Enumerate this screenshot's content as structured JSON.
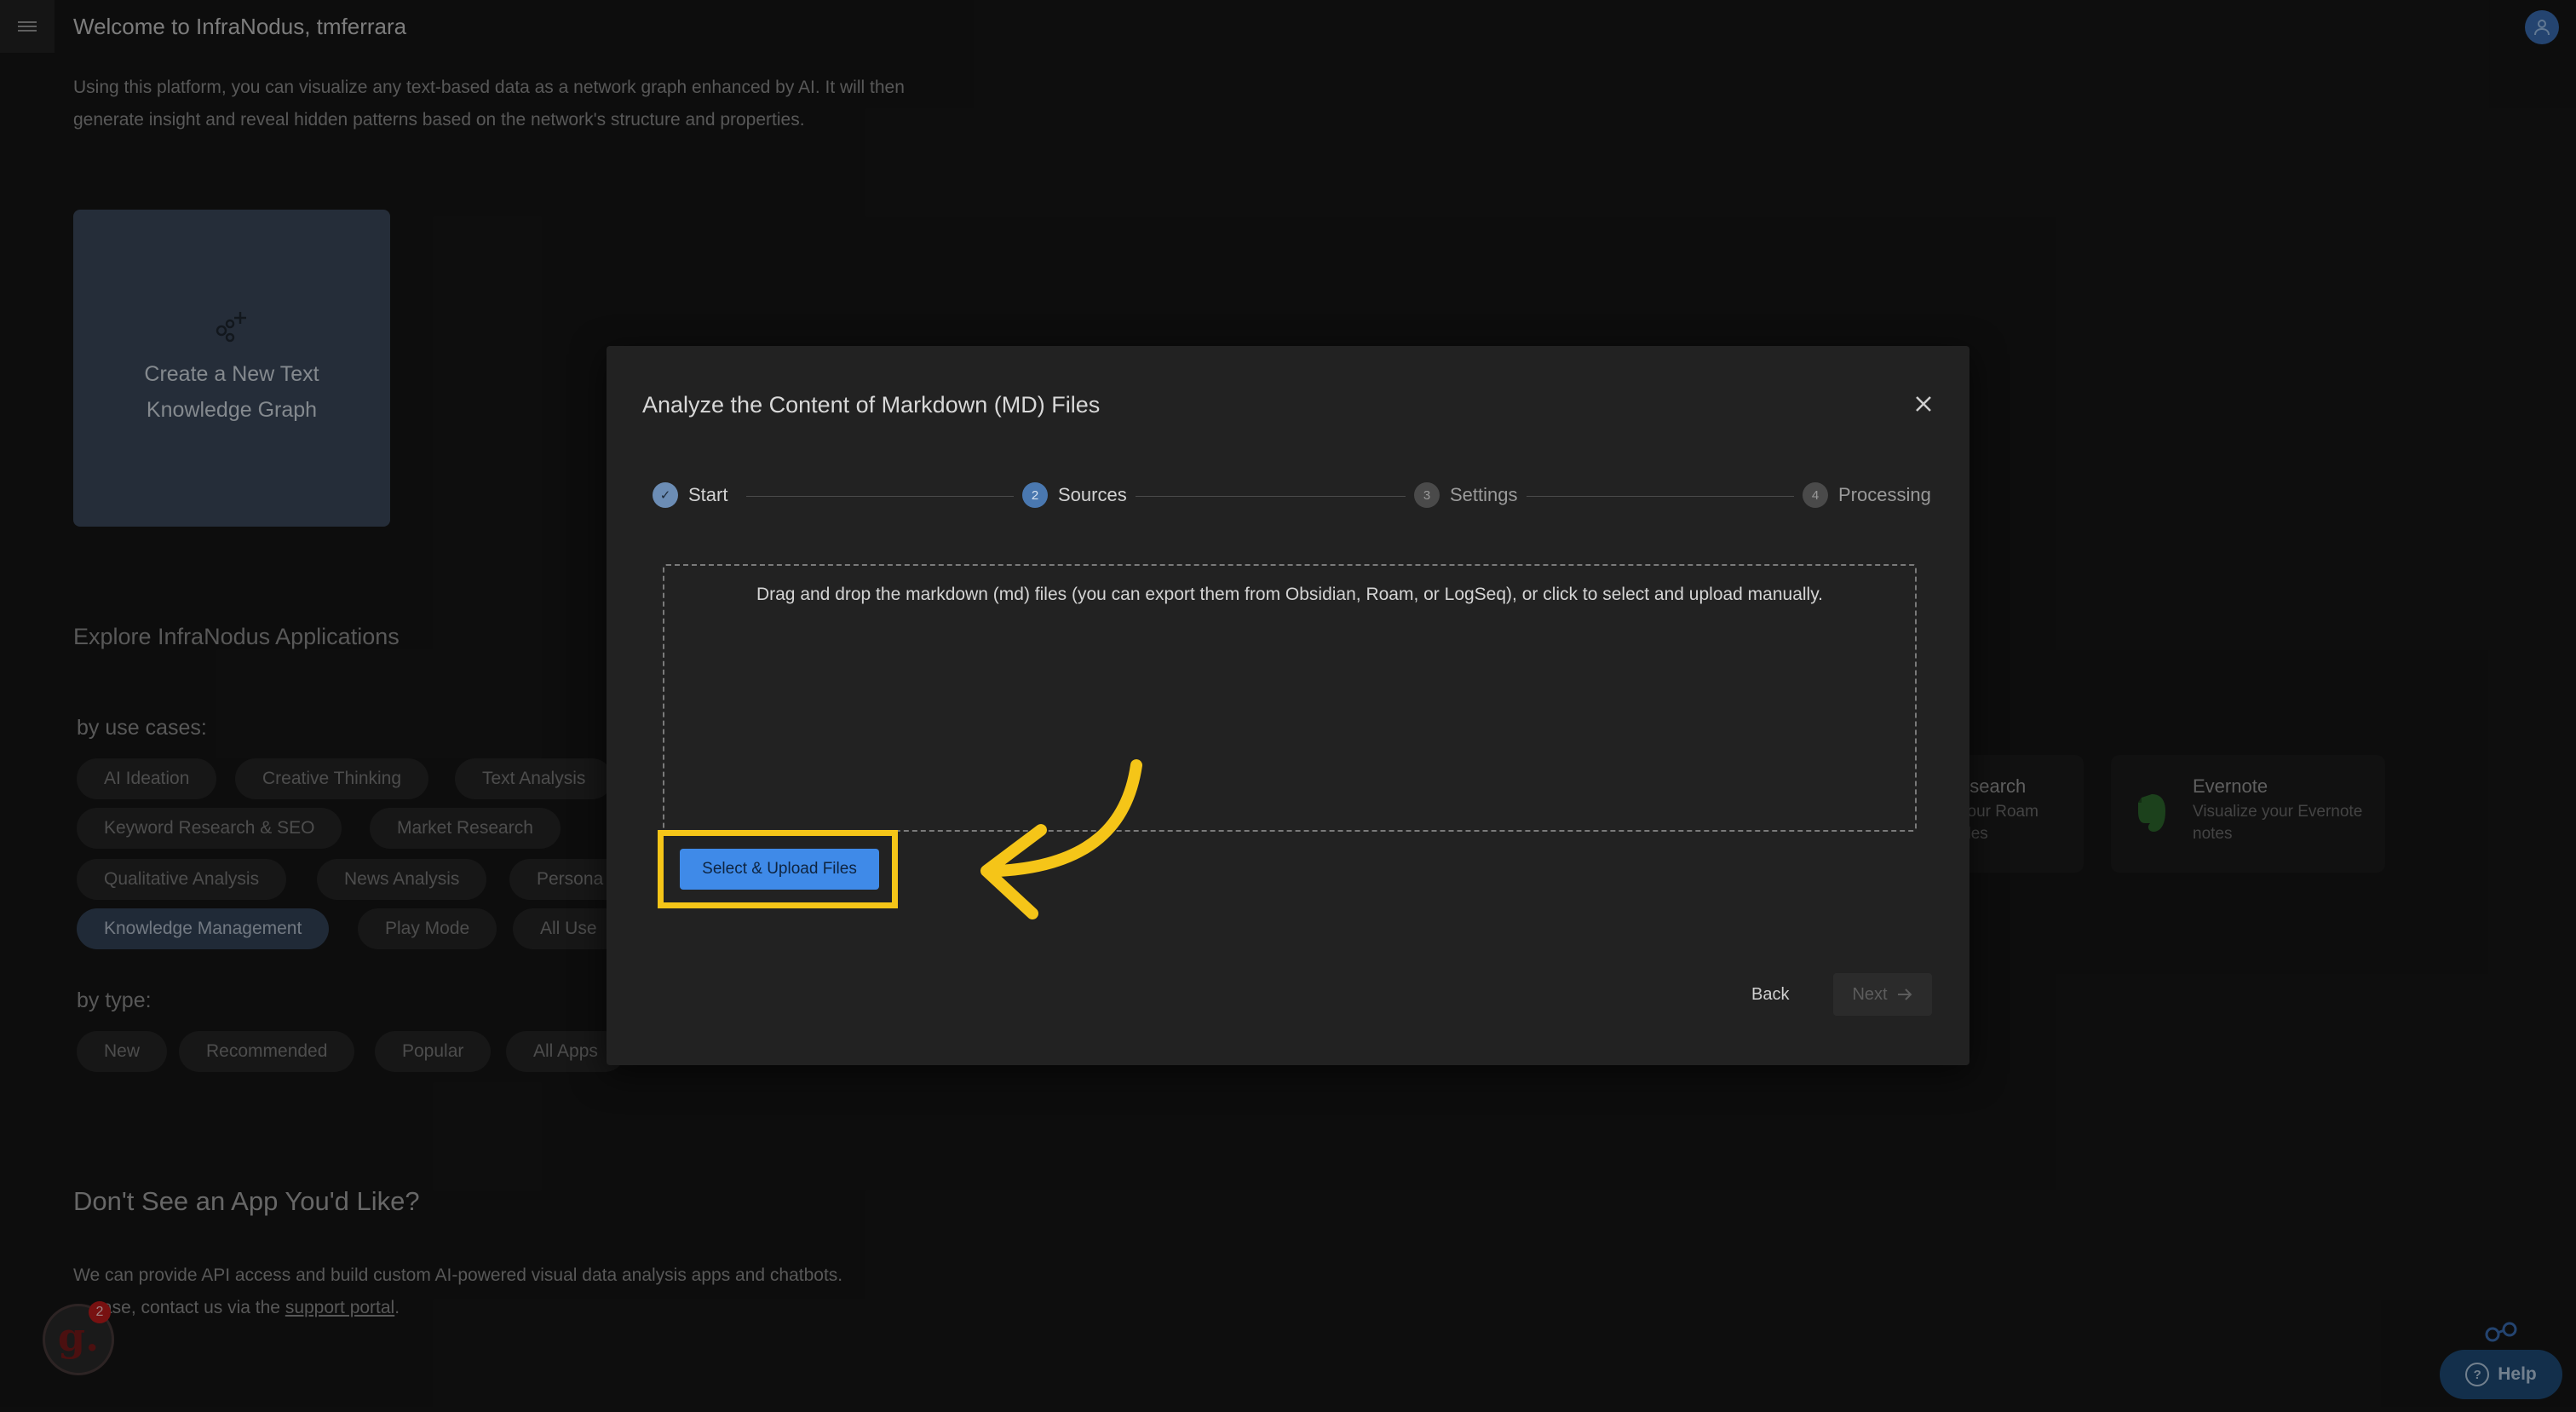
{
  "header": {
    "welcome": "Welcome to InfraNodus, tmferrara"
  },
  "intro": {
    "line1": "Using this platform, you can visualize any text-based data as a network graph enhanced by AI. It will then",
    "line2": "generate insight and reveal hidden patterns based on the network's structure and properties."
  },
  "create_card": {
    "label": "Create a New Text Knowledge Graph"
  },
  "explore": {
    "title": "Explore InfraNodus Applications",
    "use_cases_label": "by use cases:",
    "use_cases": [
      "AI Ideation",
      "Creative Thinking",
      "Text Analysis",
      "Keyword Research & SEO",
      "Market Research",
      "Qualitative Analysis",
      "News Analysis",
      "Persona",
      "Knowledge Management",
      "Play Mode",
      "All Use"
    ],
    "type_label": "by type:",
    "types": [
      "New",
      "Recommended",
      "Popular",
      "All Apps"
    ],
    "apps": [
      {
        "title": "esearch",
        "desc1": "your Roam",
        "desc2": "files"
      },
      {
        "title": "Evernote",
        "desc1": "Visualize your Evernote",
        "desc2": "notes"
      }
    ]
  },
  "dont_see": {
    "title": "Don't See an App You'd Like?",
    "text1": "We can provide API access and build custom AI-powered visual data analysis apps and chatbots.",
    "text2_prefix": "ase, contact us via the",
    "link": "support portal",
    "text2_suffix": "."
  },
  "badge_count": "2",
  "help_label": "Help",
  "modal": {
    "title": "Analyze the Content of Markdown (MD) Files",
    "steps": [
      {
        "num": "✓",
        "label": "Start",
        "state": "done"
      },
      {
        "num": "2",
        "label": "Sources",
        "state": "active"
      },
      {
        "num": "3",
        "label": "Settings",
        "state": "pending"
      },
      {
        "num": "4",
        "label": "Processing",
        "state": "pending"
      }
    ],
    "dropzone_text": "Drag and drop the markdown (md) files (you can export them from Obsidian, Roam, or LogSeq), or click to select and upload manually.",
    "upload_button": "Select & Upload Files",
    "back_button": "Back",
    "next_button": "Next"
  },
  "colors": {
    "accent": "#3f8ae8",
    "highlight": "#f5c518",
    "active_chip": "#34445a"
  }
}
